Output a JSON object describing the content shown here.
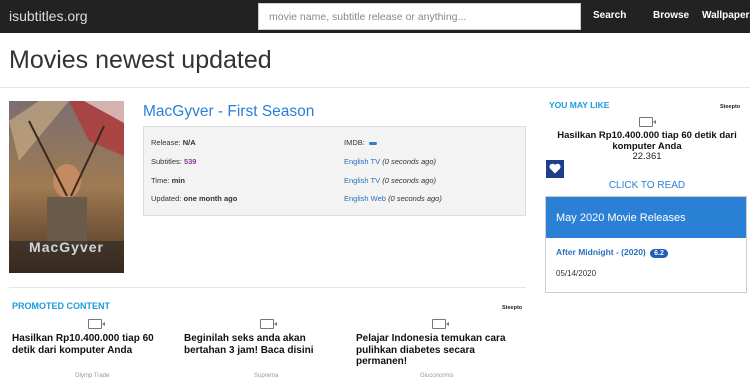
{
  "navbar": {
    "brand": "isubtitles.org",
    "search_placeholder": "movie name, subtitle release or anything...",
    "links": [
      "Search",
      "Browse",
      "Wallpapers"
    ]
  },
  "page_title": "Movies newest updated",
  "movie": {
    "poster_text": "MacGyver",
    "title": "MacGyver - First Season",
    "release_label": "Release:",
    "release_value": "N/A",
    "subtitles_label": "Subtitles:",
    "subtitles_value": "539",
    "time_label": "Time:",
    "time_value": "min",
    "updated_label": "Updated:",
    "updated_value": "one month ago",
    "imdb_label": "IMDB:",
    "recent": [
      {
        "lang": "English TV",
        "when": "(0 seconds ago)"
      },
      {
        "lang": "English TV",
        "when": "(0 seconds ago)"
      },
      {
        "lang": "English Web",
        "when": "(0 seconds ago)"
      }
    ]
  },
  "promoted": {
    "heading": "PROMOTED CONTENT",
    "provider": "Steepto",
    "items": [
      {
        "text": "Hasilkan Rp10.400.000 tiap 60 detik dari komputer Anda",
        "source": "Olymp Trade"
      },
      {
        "text": "Beginilah seks anda akan bertahan 3 jam! Baca disini",
        "source": "Suprema"
      },
      {
        "text": "Pelajar Indonesia temukan cara pulihkan diabetes secara permanen!",
        "source": "Gluconormis"
      }
    ]
  },
  "sidebar": {
    "heading": "YOU MAY LIKE",
    "provider": "Steepto",
    "ad_title": "Hasilkan Rp10.400.000 tiap 60 detik dari komputer Anda",
    "ad_count": "22.361",
    "cta": "CLICK TO READ",
    "releases": {
      "heading": "May 2020 Movie Releases",
      "item_title": "After Midnight",
      "item_year": "- (2020)",
      "item_rating": "6.2",
      "item_date": "05/14/2020"
    }
  },
  "colors": {
    "navbar": "#222222",
    "accent": "#2a80d5",
    "heading_blue": "#1a9be0",
    "badge": "#1f5fb8"
  }
}
